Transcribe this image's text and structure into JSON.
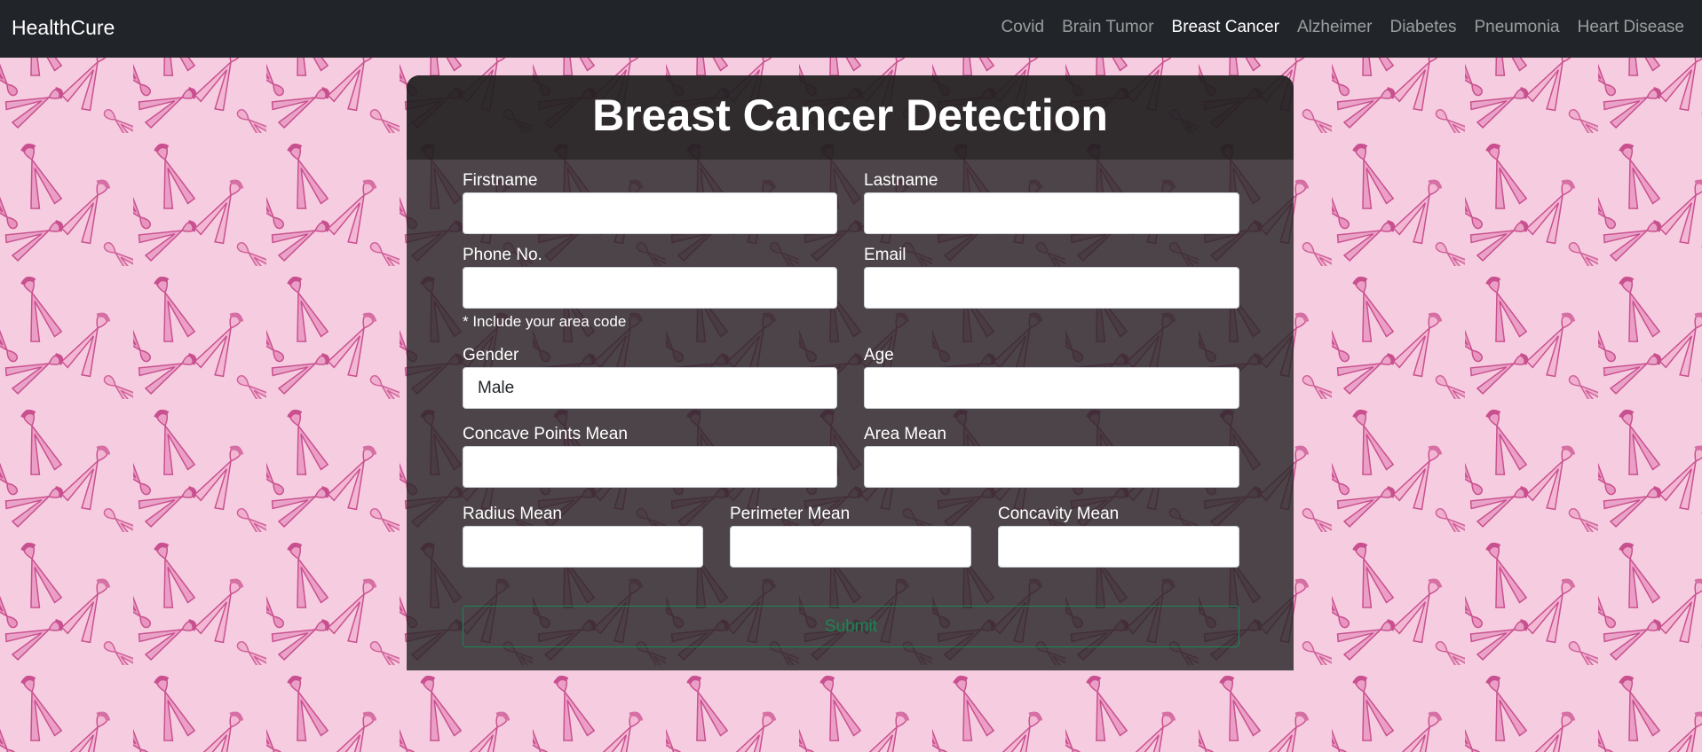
{
  "navbar": {
    "brand": "HealthCure",
    "links": [
      {
        "label": "Covid",
        "active": false
      },
      {
        "label": "Brain Tumor",
        "active": false
      },
      {
        "label": "Breast Cancer",
        "active": true
      },
      {
        "label": "Alzheimer",
        "active": false
      },
      {
        "label": "Diabetes",
        "active": false
      },
      {
        "label": "Pneumonia",
        "active": false
      },
      {
        "label": "Heart Disease",
        "active": false
      }
    ]
  },
  "form": {
    "title": "Breast Cancer Detection",
    "firstname": {
      "label": "Firstname",
      "value": ""
    },
    "lastname": {
      "label": "Lastname",
      "value": ""
    },
    "phone": {
      "label": "Phone No.",
      "value": "",
      "help": "* Include your area code"
    },
    "email": {
      "label": "Email",
      "value": ""
    },
    "gender": {
      "label": "Gender",
      "value": "Male"
    },
    "age": {
      "label": "Age",
      "value": ""
    },
    "concave_points_mean": {
      "label": "Concave Points Mean",
      "value": ""
    },
    "area_mean": {
      "label": "Area Mean",
      "value": ""
    },
    "radius_mean": {
      "label": "Radius Mean",
      "value": ""
    },
    "perimeter_mean": {
      "label": "Perimeter Mean",
      "value": ""
    },
    "concavity_mean": {
      "label": "Concavity Mean",
      "value": ""
    },
    "submit_label": "Submit"
  },
  "colors": {
    "navbar_bg": "#212529",
    "background_pink": "#f6cde0",
    "ribbon_pink": "#ec9fc6",
    "ribbon_dark": "#c9508f",
    "submit_green": "#198754"
  },
  "icons": {
    "background": "pink-ribbon-pattern"
  }
}
